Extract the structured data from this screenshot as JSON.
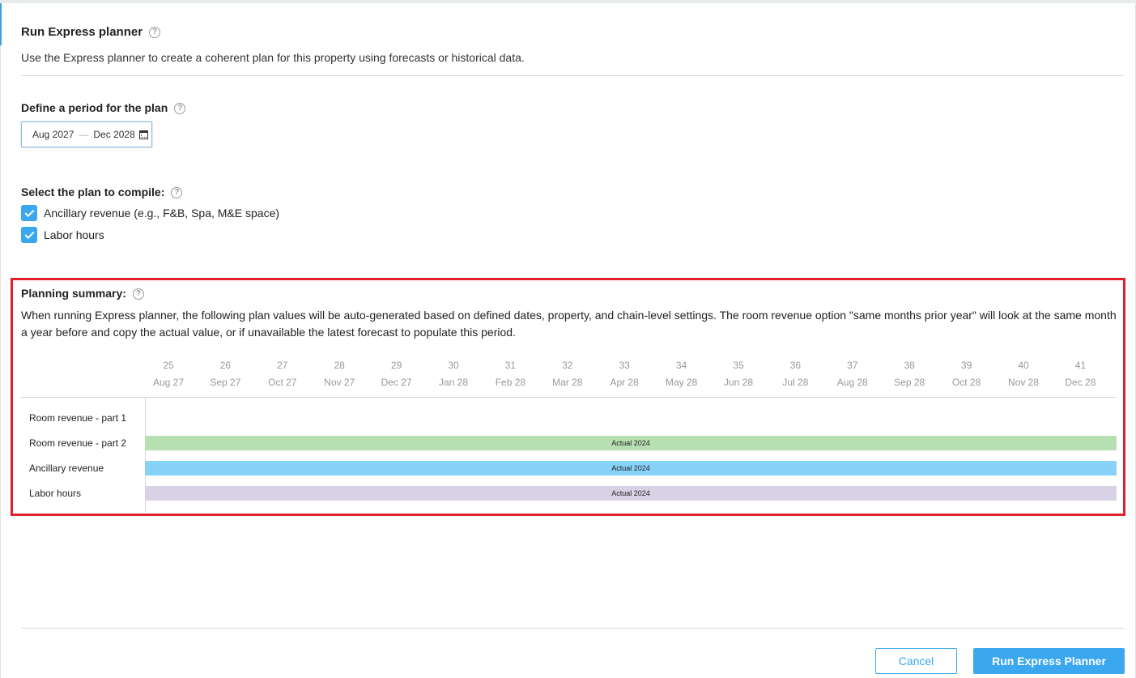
{
  "header": {
    "title": "Run Express planner",
    "subtitle": "Use the Express planner to create a coherent plan for this property using forecasts or historical data."
  },
  "period": {
    "label": "Define a period for the plan",
    "start": "Aug 2027",
    "separator": "—",
    "end": "Dec 2028"
  },
  "compile": {
    "label": "Select the plan to compile:",
    "options": [
      {
        "label": "Ancillary revenue (e.g., F&B, Spa, M&E space)",
        "checked": true
      },
      {
        "label": "Labor hours",
        "checked": true
      }
    ]
  },
  "summary": {
    "title": "Planning summary:",
    "description": "When running Express planner, the following plan values will be auto-generated based on defined dates, property, and chain-level settings. The room revenue option \"same months prior year\" will look at the same month a year before and copy the actual value, or if unavailable the latest forecast to populate this period.",
    "columns": [
      {
        "num": "25",
        "month": "Aug 27"
      },
      {
        "num": "26",
        "month": "Sep 27"
      },
      {
        "num": "27",
        "month": "Oct 27"
      },
      {
        "num": "28",
        "month": "Nov 27"
      },
      {
        "num": "29",
        "month": "Dec 27"
      },
      {
        "num": "30",
        "month": "Jan 28"
      },
      {
        "num": "31",
        "month": "Feb 28"
      },
      {
        "num": "32",
        "month": "Mar 28"
      },
      {
        "num": "33",
        "month": "Apr 28"
      },
      {
        "num": "34",
        "month": "May 28"
      },
      {
        "num": "35",
        "month": "Jun 28"
      },
      {
        "num": "36",
        "month": "Jul 28"
      },
      {
        "num": "37",
        "month": "Aug 28"
      },
      {
        "num": "38",
        "month": "Sep 28"
      },
      {
        "num": "39",
        "month": "Oct 28"
      },
      {
        "num": "40",
        "month": "Nov 28"
      },
      {
        "num": "41",
        "month": "Dec 28"
      }
    ],
    "rows": [
      {
        "label": "Room revenue - part 1",
        "bar": null,
        "color": null
      },
      {
        "label": "Room revenue - part 2",
        "bar": "Actual 2024",
        "color": "#b7e0b2"
      },
      {
        "label": "Ancillary revenue",
        "bar": "Actual 2024",
        "color": "#87d3f8"
      },
      {
        "label": "Labor hours",
        "bar": "Actual 2024",
        "color": "#d9d2e7"
      }
    ]
  },
  "footer": {
    "cancel_label": "Cancel",
    "run_label": "Run Express Planner"
  },
  "colors": {
    "accent": "#3aa7ee",
    "highlight_border": "#e0202b"
  }
}
